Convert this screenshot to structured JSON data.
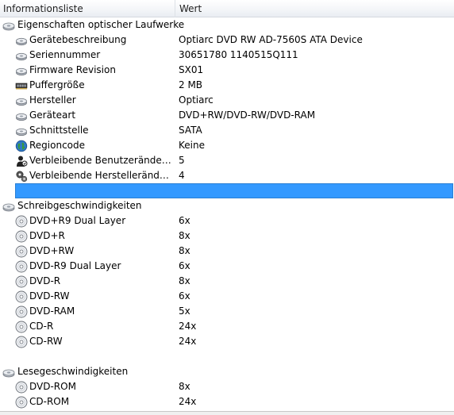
{
  "header": {
    "col_name": "Informationsliste",
    "col_value": "Wert"
  },
  "rows": [
    {
      "type": "group",
      "icon": "cd-drive-icon",
      "label": "Eigenschaften optischer Laufwerke",
      "value": ""
    },
    {
      "type": "item",
      "icon": "drive-small-icon",
      "label": "Gerätebeschreibung",
      "value": "Optiarc DVD RW AD-7560S ATA Device"
    },
    {
      "type": "item",
      "icon": "drive-small-icon",
      "label": "Seriennummer",
      "value": "30651780 1140515Q111"
    },
    {
      "type": "item",
      "icon": "drive-small-icon",
      "label": "Firmware Revision",
      "value": "SX01"
    },
    {
      "type": "item",
      "icon": "memory-chip-icon",
      "label": "Puffergröße",
      "value": "2 MB"
    },
    {
      "type": "item",
      "icon": "drive-small-icon",
      "label": "Hersteller",
      "value": "Optiarc"
    },
    {
      "type": "item",
      "icon": "drive-small-icon",
      "label": "Geräteart",
      "value": "DVD+RW/DVD-RW/DVD-RAM"
    },
    {
      "type": "item",
      "icon": "drive-small-icon",
      "label": "Schnittstelle",
      "value": "SATA"
    },
    {
      "type": "item",
      "icon": "globe-icon",
      "label": "Regioncode",
      "value": "Keine"
    },
    {
      "type": "item",
      "icon": "user-change-icon",
      "label": "Verbleibende Benutzeränderung…",
      "value": "5"
    },
    {
      "type": "item",
      "icon": "gears-icon",
      "label": "Verbleibende Herstelleränderun…",
      "value": "4"
    },
    {
      "type": "selected",
      "icon": "",
      "label": "",
      "value": ""
    },
    {
      "type": "group",
      "icon": "cd-drive-icon",
      "label": "Schreibgeschwindigkeiten",
      "value": ""
    },
    {
      "type": "item",
      "icon": "disc-icon",
      "label": "DVD+R9 Dual Layer",
      "value": "6x"
    },
    {
      "type": "item",
      "icon": "disc-icon",
      "label": "DVD+R",
      "value": "8x"
    },
    {
      "type": "item",
      "icon": "disc-icon",
      "label": "DVD+RW",
      "value": "8x"
    },
    {
      "type": "item",
      "icon": "disc-icon",
      "label": "DVD-R9 Dual Layer",
      "value": "6x"
    },
    {
      "type": "item",
      "icon": "disc-icon",
      "label": "DVD-R",
      "value": "8x"
    },
    {
      "type": "item",
      "icon": "disc-icon",
      "label": "DVD-RW",
      "value": "6x"
    },
    {
      "type": "item",
      "icon": "disc-icon",
      "label": "DVD-RAM",
      "value": "5x"
    },
    {
      "type": "item",
      "icon": "disc-icon",
      "label": "CD-R",
      "value": "24x"
    },
    {
      "type": "item",
      "icon": "disc-icon",
      "label": "CD-RW",
      "value": "24x"
    },
    {
      "type": "blank",
      "icon": "",
      "label": "",
      "value": ""
    },
    {
      "type": "group",
      "icon": "cd-drive-icon",
      "label": "Lesegeschwindigkeiten",
      "value": ""
    },
    {
      "type": "item",
      "icon": "disc-icon",
      "label": "DVD-ROM",
      "value": "8x"
    },
    {
      "type": "item",
      "icon": "disc-icon",
      "label": "CD-ROM",
      "value": "24x"
    }
  ],
  "colors": {
    "selection": "#3399ff",
    "header_bg": "#f3f5f8"
  }
}
